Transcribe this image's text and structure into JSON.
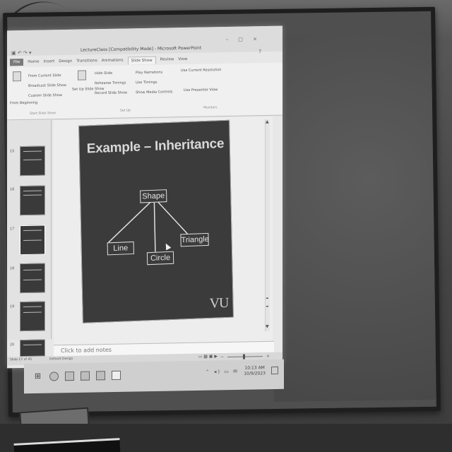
{
  "window": {
    "title": "LectureClass [Compatibility Mode] - Microsoft PowerPoint",
    "controls": "– □ ×",
    "help": "?"
  },
  "ribbon": {
    "tabs": [
      "File",
      "Home",
      "Insert",
      "Design",
      "Transitions",
      "Animations",
      "Slide Show",
      "Review",
      "View"
    ],
    "active_tab": "Slide Show",
    "start_group": {
      "from_beginning": "From Beginning",
      "from_current": "From Current Slide",
      "broadcast": "Broadcast Slide Show",
      "custom": "Custom Slide Show",
      "label": "Start Slide Show"
    },
    "setup_group": {
      "setup": "Set Up Slide Show",
      "hide": "Hide Slide",
      "rehearse": "Rehearse Timings",
      "record": "Record Slide Show",
      "play_narrations": "Play Narrations",
      "use_timings": "Use Timings",
      "media_controls": "Show Media Controls",
      "label": "Set Up"
    },
    "monitors_group": {
      "resolution": "Use Current Resolution",
      "presenter_view": "Use Presenter View",
      "label": "Monitors"
    }
  },
  "thumbnails": {
    "numbers": [
      "15",
      "16",
      "17",
      "18",
      "19",
      "20"
    ]
  },
  "slide": {
    "title": "Example – Inheritance",
    "nodes": {
      "root": "Shape",
      "left": "Line",
      "middle": "Circle",
      "right": "Triangle"
    },
    "logo": "VU"
  },
  "notes": {
    "placeholder": "Click to add notes"
  },
  "status": {
    "slide_info": "Slide 17 of 45",
    "theme": "Default Design"
  },
  "taskbar": {
    "time": "10:13 AM",
    "date": "10/9/2023"
  }
}
